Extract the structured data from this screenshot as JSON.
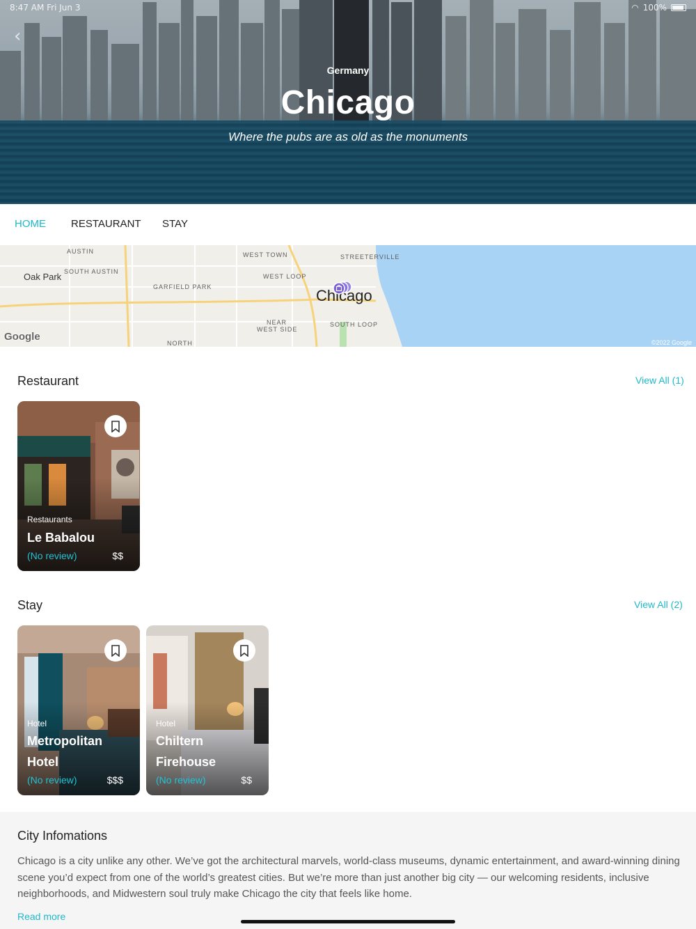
{
  "status_bar": {
    "time": "8:47 AM   Fri Jun 3",
    "battery": "100%"
  },
  "hero": {
    "country": "Germany",
    "city": "Chicago",
    "tagline": "Where the pubs are as old as the monuments"
  },
  "tabs": [
    {
      "label": "HOME",
      "active": true
    },
    {
      "label": "RESTAURANT",
      "active": false
    },
    {
      "label": "STAY",
      "active": false
    }
  ],
  "map": {
    "labels": {
      "austin": "AUSTIN",
      "oak_park": "Oak Park",
      "south_austin": "SOUTH AUSTIN",
      "west_town": "WEST TOWN",
      "west_loop": "WEST LOOP",
      "streeterville": "STREETERVILLE",
      "garfield_park": "GARFIELD PARK",
      "chicago": "Chicago",
      "near_west_side_1": "NEAR",
      "near_west_side_2": "WEST SIDE",
      "south_loop": "SOUTH LOOP",
      "north": "NORTH"
    },
    "google": "Google",
    "copyright": "©2022 Google"
  },
  "restaurant": {
    "title": "Restaurant",
    "view_all": "View All (1)",
    "items": [
      {
        "category": "Restaurants",
        "name": "Le Babalou",
        "review": "(No review)",
        "price": "$$"
      }
    ]
  },
  "stay": {
    "title": "Stay",
    "view_all": "View All (2)",
    "items": [
      {
        "category": "Hotel",
        "name": "Metropolitan Hotel",
        "review": "(No review)",
        "price": "$$$"
      },
      {
        "category": "Hotel",
        "name": "Chiltern Firehouse",
        "review": "(No review)",
        "price": "$$"
      }
    ]
  },
  "city_info": {
    "title": "City Infomations",
    "description": "Chicago is a city unlike any other. We’ve got the architectural marvels, world-class museums, dynamic entertainment, and award-winning dining scene you’d expect from one of the world’s greatest cities. But we’re more than just another big city — our welcoming residents, inclusive neighborhoods, and Midwestern soul truly make Chicago the city that feels like home.",
    "read_more": "Read more"
  },
  "colors": {
    "accent": "#1fb8c9",
    "lake": "#a9d3f5",
    "pin": "#7a5fd6"
  }
}
